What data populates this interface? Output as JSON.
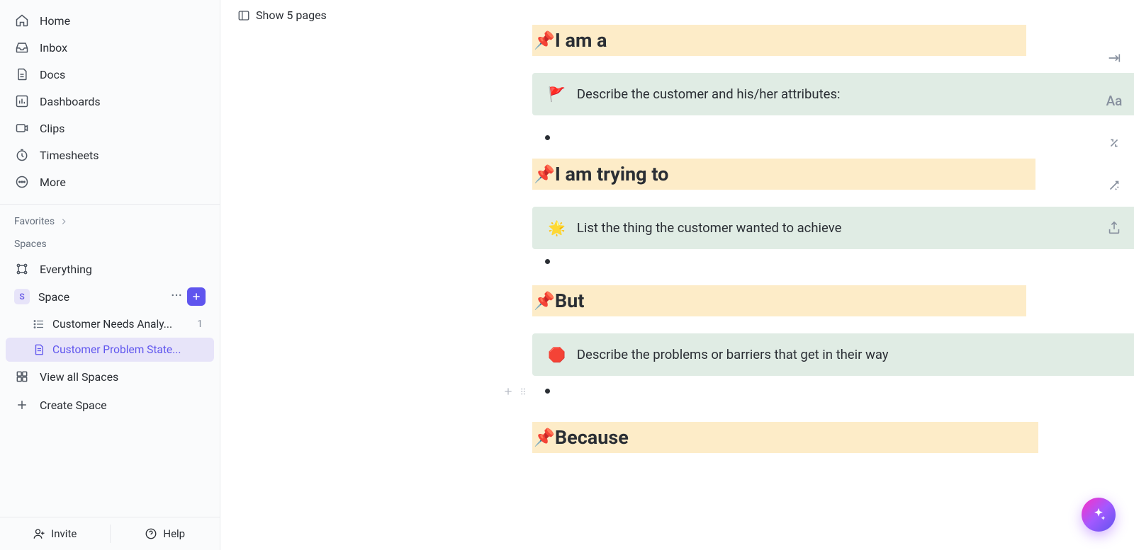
{
  "nav": [
    {
      "label": "Home"
    },
    {
      "label": "Inbox"
    },
    {
      "label": "Docs"
    },
    {
      "label": "Dashboards"
    },
    {
      "label": "Clips"
    },
    {
      "label": "Timesheets"
    },
    {
      "label": "More"
    }
  ],
  "sections": {
    "favorites": "Favorites",
    "spaces": "Spaces"
  },
  "space": {
    "badge": "S",
    "label": "Space",
    "items": [
      {
        "label": "Everything"
      },
      {
        "label": "Customer Needs Analy...",
        "count": "1"
      },
      {
        "label": "Customer Problem State..."
      },
      {
        "label": "View all Spaces"
      },
      {
        "label": "Create Space"
      }
    ]
  },
  "footer": {
    "invite": "Invite",
    "help": "Help"
  },
  "pages_toggle": "Show 5 pages",
  "doc": {
    "sections": [
      {
        "pin": "📌",
        "heading": "I am a",
        "callout_emoji": "🚩",
        "callout_text": "Describe the customer and his/her attributes:"
      },
      {
        "pin": "📌",
        "heading": "I am trying to",
        "callout_emoji": "🌟",
        "callout_text": "List the thing the customer wanted to achieve"
      },
      {
        "pin": "📌",
        "heading": "But",
        "callout_emoji": "🛑",
        "callout_text": "Describe the problems or barriers that get in their way"
      },
      {
        "pin": "📌",
        "heading": "Because",
        "callout_emoji": "",
        "callout_text": ""
      }
    ]
  }
}
